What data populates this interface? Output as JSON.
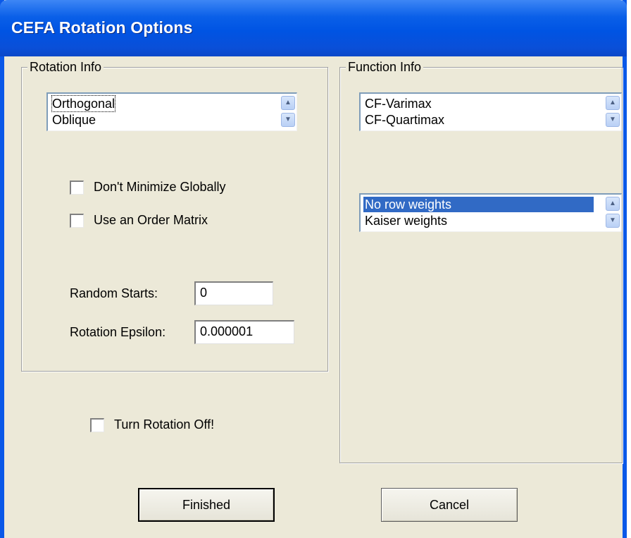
{
  "window": {
    "title": "CEFA Rotation Options"
  },
  "rotation_info": {
    "label": "Rotation Info",
    "list": [
      "Orthogonal",
      "Oblique"
    ],
    "dont_minimize_globally": {
      "label": "Don't Minimize Globally",
      "checked": false
    },
    "use_order_matrix": {
      "label": "Use an Order Matrix",
      "checked": false
    },
    "random_starts": {
      "label": "Random Starts:",
      "value": "0"
    },
    "rotation_epsilon": {
      "label": "Rotation Epsilon:",
      "value": "0.000001"
    }
  },
  "turn_rotation_off": {
    "label": "Turn Rotation Off!",
    "checked": false
  },
  "function_info": {
    "label": "Function Info",
    "function_list": [
      "CF-Varimax",
      "CF-Quartimax"
    ],
    "weights_list": [
      "No row weights",
      "Kaiser weights"
    ],
    "weights_selected": "No row weights"
  },
  "buttons": {
    "finished": "Finished",
    "cancel": "Cancel"
  },
  "icons": {
    "spin_up": "spin-up-icon",
    "spin_down": "spin-down-icon"
  },
  "colors": {
    "title_bar": "#0054e3",
    "selection": "#316ac5",
    "dialog_bg": "#ece9d8"
  }
}
